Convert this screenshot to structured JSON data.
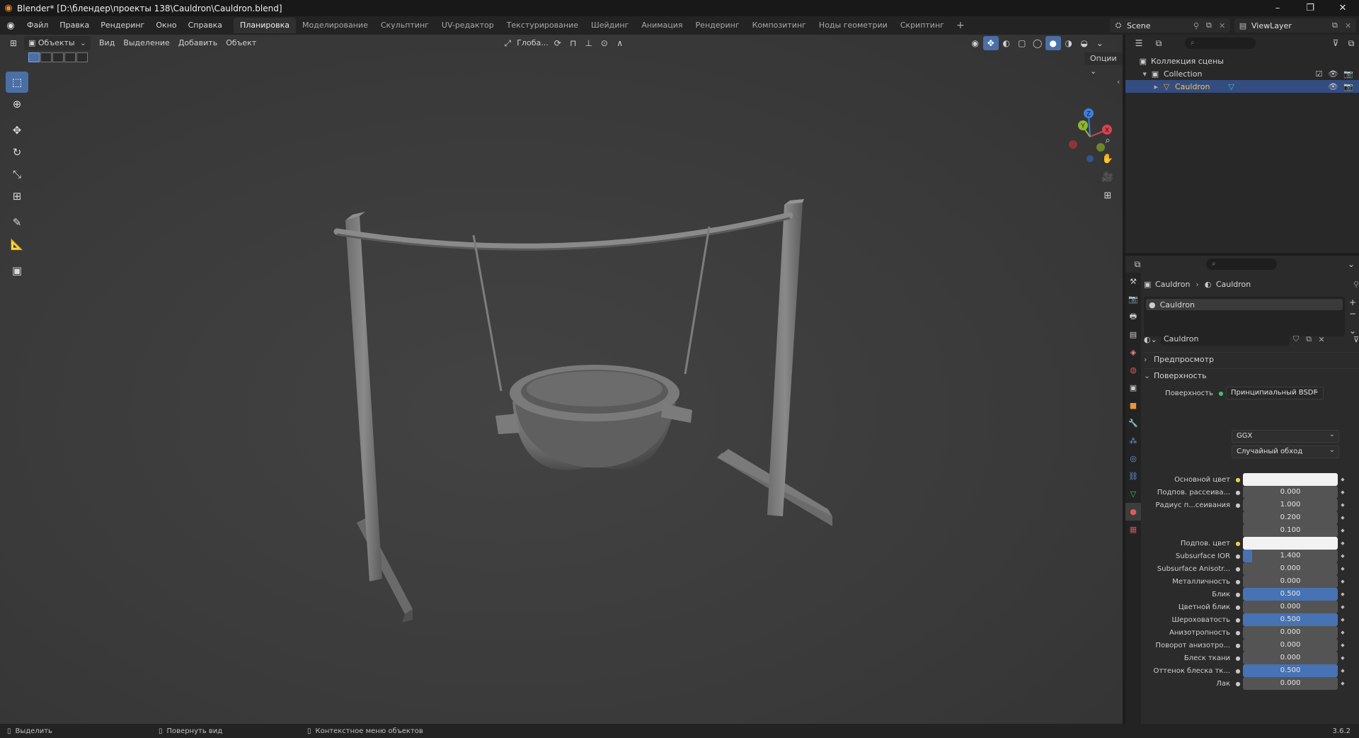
{
  "window": {
    "title": "Blender* [D:\\блендер\\проекты 138\\Cauldron\\Cauldron.blend]",
    "controls": [
      "–",
      "❐",
      "✕"
    ]
  },
  "menu": {
    "items": [
      "Файл",
      "Правка",
      "Рендеринг",
      "Окно",
      "Справка"
    ],
    "workspaces": [
      "Планировка",
      "Моделирование",
      "Скульптинг",
      "UV-редактор",
      "Текстурирование",
      "Шейдинг",
      "Анимация",
      "Рендеринг",
      "Композитинг",
      "Ноды геометрии",
      "Скриптинг"
    ],
    "active_workspace": "Планировка",
    "add_tab": "+",
    "scene_name": "Scene",
    "view_layer": "ViewLayer"
  },
  "viewport": {
    "mode": "Объекты",
    "menus": [
      "Вид",
      "Выделение",
      "Добавить",
      "Объект"
    ],
    "orientation": "Глоба...",
    "options": "Опции",
    "gizmo_axes": {
      "x": "X",
      "y": "Y",
      "z": "Z"
    },
    "colors": {
      "x_axis": "#d8434f",
      "y_axis": "#8fb730",
      "z_axis": "#3f7fd8",
      "active_tool": "#4a6fa5"
    }
  },
  "outliner": {
    "rows": [
      {
        "label": "Коллекция сцены"
      },
      {
        "label": "Collection"
      },
      {
        "label": "Cauldron"
      }
    ]
  },
  "properties": {
    "breadcrumb": [
      "Cauldron",
      "Cauldron"
    ],
    "material_slot": "Cauldron",
    "material_name": "Cauldron",
    "sections": {
      "preview": "Предпросмотр",
      "surface": "Поверхность"
    },
    "surface_label": "Поверхность",
    "surface_value": "Принципиальный BSDF",
    "distribution": "GGX",
    "subsurface_method": "Случайный обход",
    "fields": [
      {
        "label": "Основной цвет",
        "type": "color",
        "value": ""
      },
      {
        "label": "Подпов. рассеива...",
        "type": "num",
        "value": "0.000",
        "fill": 0
      },
      {
        "label": "Радиус п...сеивания",
        "type": "num",
        "value": "1.000",
        "fill": 0
      },
      {
        "label": "",
        "type": "num",
        "value": "0.200",
        "fill": 0
      },
      {
        "label": "",
        "type": "num",
        "value": "0.100",
        "fill": 0
      },
      {
        "label": "Подпов. цвет",
        "type": "color",
        "value": ""
      },
      {
        "label": "Subsurface IOR",
        "type": "num",
        "value": "1.400",
        "fill": 0.1
      },
      {
        "label": "Subsurface Anisotr...",
        "type": "num",
        "value": "0.000",
        "fill": 0
      },
      {
        "label": "Металличность",
        "type": "num",
        "value": "0.000",
        "fill": 0
      },
      {
        "label": "Блик",
        "type": "num",
        "value": "0.500",
        "fill": 1
      },
      {
        "label": "Цветной блик",
        "type": "num",
        "value": "0.000",
        "fill": 0
      },
      {
        "label": "Шероховатость",
        "type": "num",
        "value": "0.500",
        "fill": 1
      },
      {
        "label": "Анизотропность",
        "type": "num",
        "value": "0.000",
        "fill": 0
      },
      {
        "label": "Поворот анизотро...",
        "type": "num",
        "value": "0.000",
        "fill": 0
      },
      {
        "label": "Блеск ткани",
        "type": "num",
        "value": "0.000",
        "fill": 0
      },
      {
        "label": "Оттенок блеска тк...",
        "type": "num",
        "value": "0.500",
        "fill": 1
      },
      {
        "label": "Лак",
        "type": "num",
        "value": "0.000",
        "fill": 0
      }
    ]
  },
  "status": {
    "select": "Выделить",
    "rotate": "Повернуть вид",
    "context_menu": "Контекстное меню объектов",
    "version": "3.6.2"
  }
}
